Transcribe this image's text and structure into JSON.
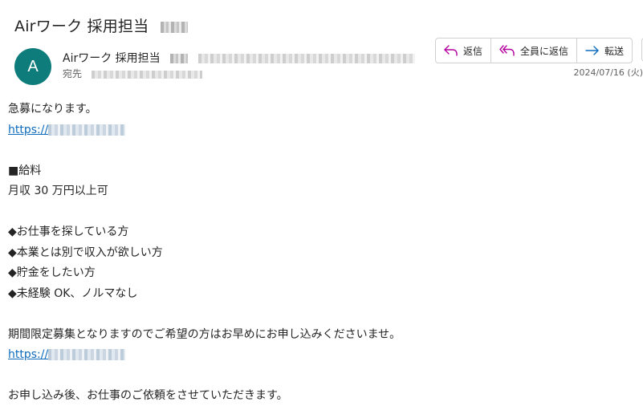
{
  "subject": "Airワーク 採用担当",
  "avatar_letter": "A",
  "sender_name": "Airワーク 採用担当",
  "to_label": "宛先",
  "actions": {
    "reply": "返信",
    "reply_all": "全員に返信",
    "forward": "転送"
  },
  "date": "2024/07/16 (火)",
  "body": {
    "intro": "急募になります。",
    "link1": "https://",
    "salary_heading": "■給料",
    "salary_value": "月収 30 万円以上可",
    "bullets": [
      "◆お仕事を探している方",
      "◆本業とは別で収入が欲しい方",
      "◆貯金をしたい方",
      "◆未経験 OK、ノルマなし"
    ],
    "limited": "期間限定募集となりますのでご希望の方はお早めにお申し込みくださいませ。",
    "link2": "https://",
    "closing": "お申し込み後、お仕事のご依頼をさせていただきます。"
  },
  "colors": {
    "avatar_bg": "#0e7c7b",
    "link": "#0f6cbd",
    "reply_icon": "#b4009e",
    "forward_icon": "#0f6cbd"
  }
}
